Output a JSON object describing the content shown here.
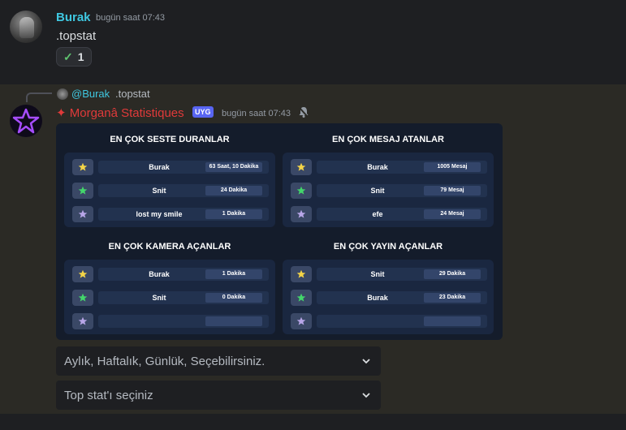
{
  "message1": {
    "username": "Burak",
    "timestamp": "bugün saat 07:43",
    "content": ".topstat",
    "reaction": {
      "emoji": "✓",
      "count": "1"
    }
  },
  "message2": {
    "reply": {
      "user": "@Burak",
      "text": ".topstat"
    },
    "bot_name": "✦ Morganâ Statistiques",
    "badge": "UYG",
    "timestamp": "bugün saat 07:43",
    "panels": [
      {
        "title": "EN ÇOK SESTE DURANLAR",
        "rows": [
          {
            "star": "gold",
            "name": "Burak",
            "value": "63 Saat, 10 Dakika"
          },
          {
            "star": "green",
            "name": "Snit",
            "value": "24 Dakika"
          },
          {
            "star": "lavender",
            "name": "lost my smile",
            "value": "1 Dakika"
          }
        ]
      },
      {
        "title": "EN ÇOK MESAJ ATANLAR",
        "rows": [
          {
            "star": "gold",
            "name": "Burak",
            "value": "1005 Mesaj"
          },
          {
            "star": "green",
            "name": "Snit",
            "value": "79 Mesaj"
          },
          {
            "star": "lavender",
            "name": "efe",
            "value": "24 Mesaj"
          }
        ]
      },
      {
        "title": "EN ÇOK KAMERA AÇANLAR",
        "rows": [
          {
            "star": "gold",
            "name": "Burak",
            "value": "1 Dakika"
          },
          {
            "star": "green",
            "name": "Snit",
            "value": "0 Dakika"
          },
          {
            "star": "lavender",
            "name": "",
            "value": ""
          }
        ]
      },
      {
        "title": "EN ÇOK YAYIN AÇANLAR",
        "rows": [
          {
            "star": "gold",
            "name": "Snit",
            "value": "29 Dakika"
          },
          {
            "star": "green",
            "name": "Burak",
            "value": "23 Dakika"
          },
          {
            "star": "lavender",
            "name": "",
            "value": ""
          }
        ]
      }
    ],
    "select1_placeholder": "Aylık, Haftalık, Günlük, Seçebilirsiniz.",
    "select2_placeholder": "Top stat'ı seçiniz"
  },
  "colors": {
    "username": "#3fc7e0",
    "bot_name": "#e03a3a",
    "star_gold": "#f5d547",
    "star_green": "#43d66b",
    "star_lavender": "#b8a6e8"
  }
}
